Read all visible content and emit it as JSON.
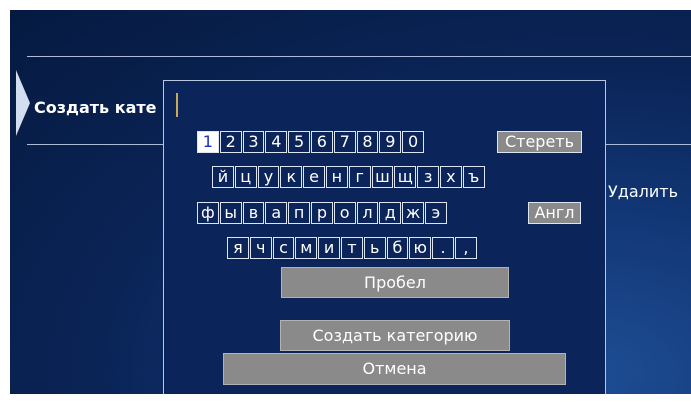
{
  "menu": {
    "create_label": "Создать кате",
    "delete_label": "Удалить"
  },
  "keyboard": {
    "rows": [
      [
        "1",
        "2",
        "3",
        "4",
        "5",
        "6",
        "7",
        "8",
        "9",
        "0"
      ],
      [
        "й",
        "ц",
        "у",
        "к",
        "е",
        "н",
        "г",
        "ш",
        "щ",
        "з",
        "х",
        "ъ"
      ],
      [
        "ф",
        "ы",
        "в",
        "а",
        "п",
        "р",
        "о",
        "л",
        "д",
        "ж",
        "э"
      ],
      [
        "я",
        "ч",
        "с",
        "м",
        "и",
        "т",
        "ь",
        "б",
        "ю",
        ".",
        ","
      ]
    ],
    "erase_label": "Стереть",
    "lang_label": "Англ",
    "space_label": "Пробел",
    "selected_key": "1"
  },
  "dialog": {
    "input_value": "",
    "create_button": "Создать категорию",
    "cancel_button": "Отмена"
  }
}
